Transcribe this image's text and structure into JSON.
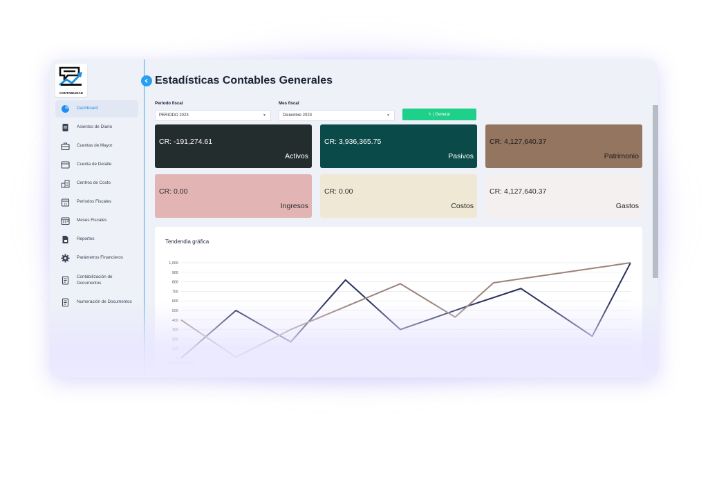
{
  "app": {
    "logo_text": "CONTABILIDAD"
  },
  "sidebar": {
    "items": [
      {
        "label": "Dashboard",
        "icon": "pie-chart-icon"
      },
      {
        "label": "Asientos de Diario",
        "icon": "journal-icon"
      },
      {
        "label": "Cuentas de Mayor",
        "icon": "briefcase-icon"
      },
      {
        "label": "Cuenta de Detalle",
        "icon": "card-icon"
      },
      {
        "label": "Centros de Costo",
        "icon": "buildings-icon"
      },
      {
        "label": "Períodos Fiscales",
        "icon": "calendar-icon"
      },
      {
        "label": "Meses Fiscales",
        "icon": "calendar-grid-icon"
      },
      {
        "label": "Reportes",
        "icon": "report-icon"
      },
      {
        "label": "Parámetros Financieros",
        "icon": "gear-icon"
      },
      {
        "label": "Contabilización de Documentos",
        "icon": "document-icon"
      },
      {
        "label": "Numeración de Documentos",
        "icon": "document-icon"
      }
    ]
  },
  "header": {
    "title": "Estadísticas Contables Generales"
  },
  "filters": {
    "periodo_label": "Período fiscal",
    "periodo_value": "PERIODO 2023",
    "mes_label": "Mes fiscal",
    "mes_value": "Diciembre 2023",
    "generate_label": "| Generar"
  },
  "cards": [
    {
      "amount": "CR: -191,274.61",
      "name": "Activos",
      "color": "#232d2e"
    },
    {
      "amount": "CR: 3,936,365.75",
      "name": "Pasivos",
      "color": "#0a4a48"
    },
    {
      "amount": "CR: 4,127,640.37",
      "name": "Patrimonio",
      "color": "#947560"
    },
    {
      "amount": "CR: 0.00",
      "name": "Ingresos",
      "color": "#e2b4b4"
    },
    {
      "amount": "CR: 0.00",
      "name": "Costos",
      "color": "#efe8d4"
    },
    {
      "amount": "CR: 4,127,640.37",
      "name": "Gastos",
      "color": "#f4f0f0"
    }
  ],
  "chart": {
    "title": "Tendendia gráfica",
    "x_first_label": "Diciembre 2023"
  },
  "chart_data": {
    "type": "line",
    "title": "Tendendia gráfica",
    "yticks": [
      0,
      100,
      200,
      300,
      400,
      500,
      600,
      700,
      800,
      900,
      1000
    ],
    "ylim": [
      0,
      1000
    ],
    "x": [
      0,
      1,
      2,
      3,
      4,
      5,
      6,
      7,
      8,
      9
    ],
    "series": [
      {
        "color": "#2a2f5e",
        "values": [
          0,
          500,
          170,
          820,
          300,
          540,
          730,
          230,
          1000
        ],
        "x": [
          0,
          1,
          2,
          3,
          4,
          5.2,
          6.2,
          7.5,
          8.2
        ]
      },
      {
        "color": "#9a837b",
        "values": [
          400,
          10,
          300,
          780,
          430,
          790,
          1000
        ],
        "x": [
          0,
          1,
          2,
          4,
          5,
          5.7,
          8.2
        ]
      }
    ],
    "grid": true
  }
}
